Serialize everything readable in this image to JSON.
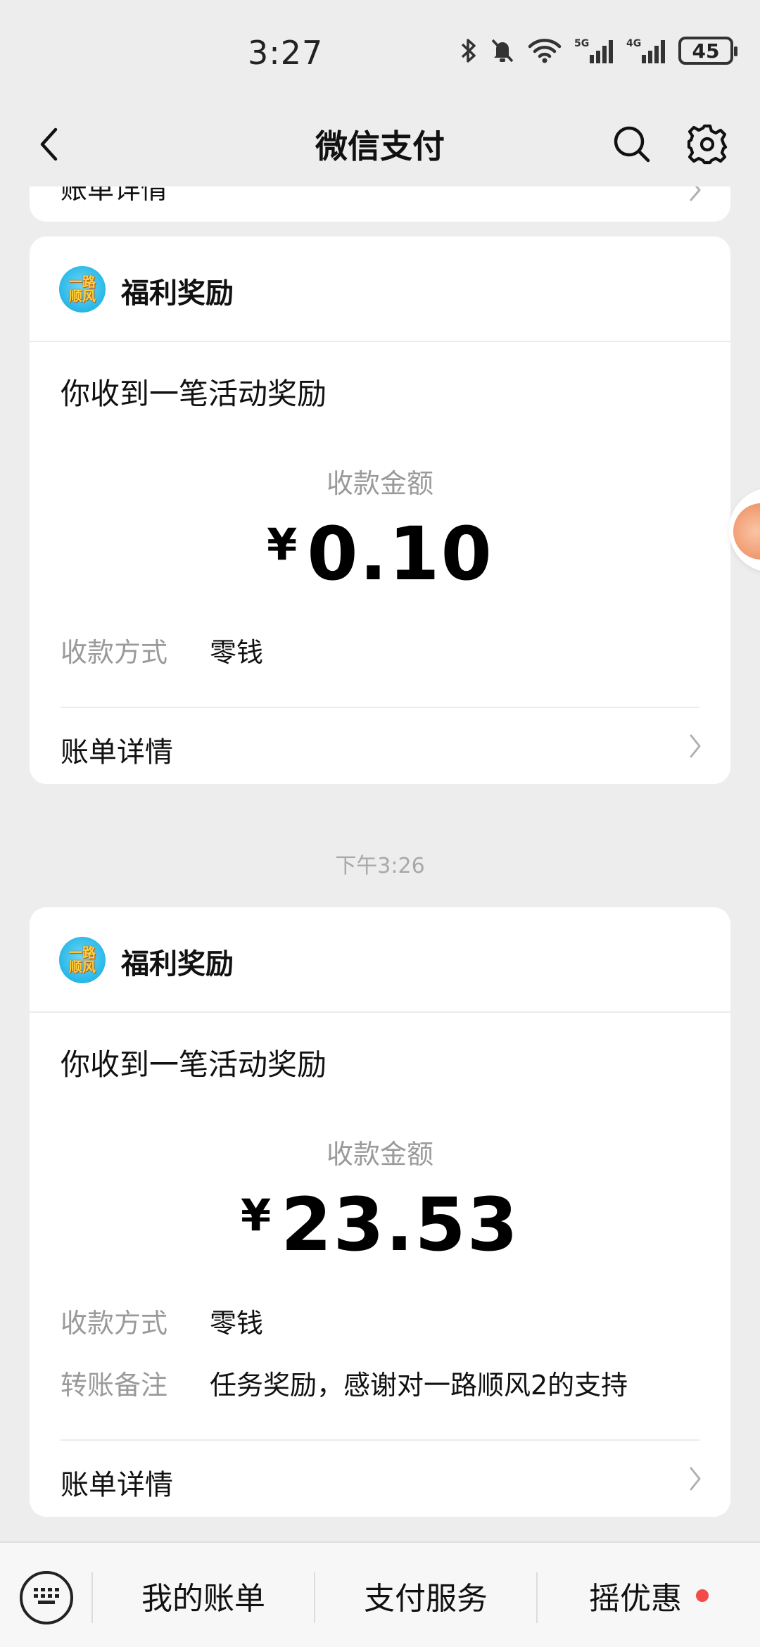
{
  "status_bar": {
    "time": "3:27",
    "battery": "45",
    "icons": [
      "bluetooth-icon",
      "bell-muted-icon",
      "wifi-icon",
      "signal-5g-icon",
      "signal-4g-icon",
      "battery-icon"
    ]
  },
  "header": {
    "title": "微信支付",
    "icons": [
      "chevron-left-icon",
      "search-icon",
      "gear-icon"
    ]
  },
  "partial_card": {
    "label": "账单详情"
  },
  "cards": [
    {
      "app_name": "福利奖励",
      "logo_text": [
        "一路",
        "顺风"
      ],
      "headline": "你收到一笔活动奖励",
      "amount_label": "收款金额",
      "currency": "¥",
      "amount": "0.10",
      "method_key": "收款方式",
      "method_value": "零钱",
      "details_label": "账单详情"
    },
    {
      "app_name": "福利奖励",
      "logo_text": [
        "一路",
        "顺风"
      ],
      "headline": "你收到一笔活动奖励",
      "amount_label": "收款金额",
      "currency": "¥",
      "amount": "23.53",
      "method_key": "收款方式",
      "method_value": "零钱",
      "note_key": "转账备注",
      "note_value": "任务奖励，感谢对一路顺风2的支持",
      "details_label": "账单详情"
    }
  ],
  "timestamp": "下午3:26",
  "bottom_bar": {
    "tabs": [
      "我的账单",
      "支付服务",
      "摇优惠"
    ],
    "has_red_dot": true
  },
  "colors": {
    "background": "#ededed",
    "card": "#ffffff",
    "secondary_text": "#9a9a9a",
    "red_dot": "#f44a4a"
  }
}
